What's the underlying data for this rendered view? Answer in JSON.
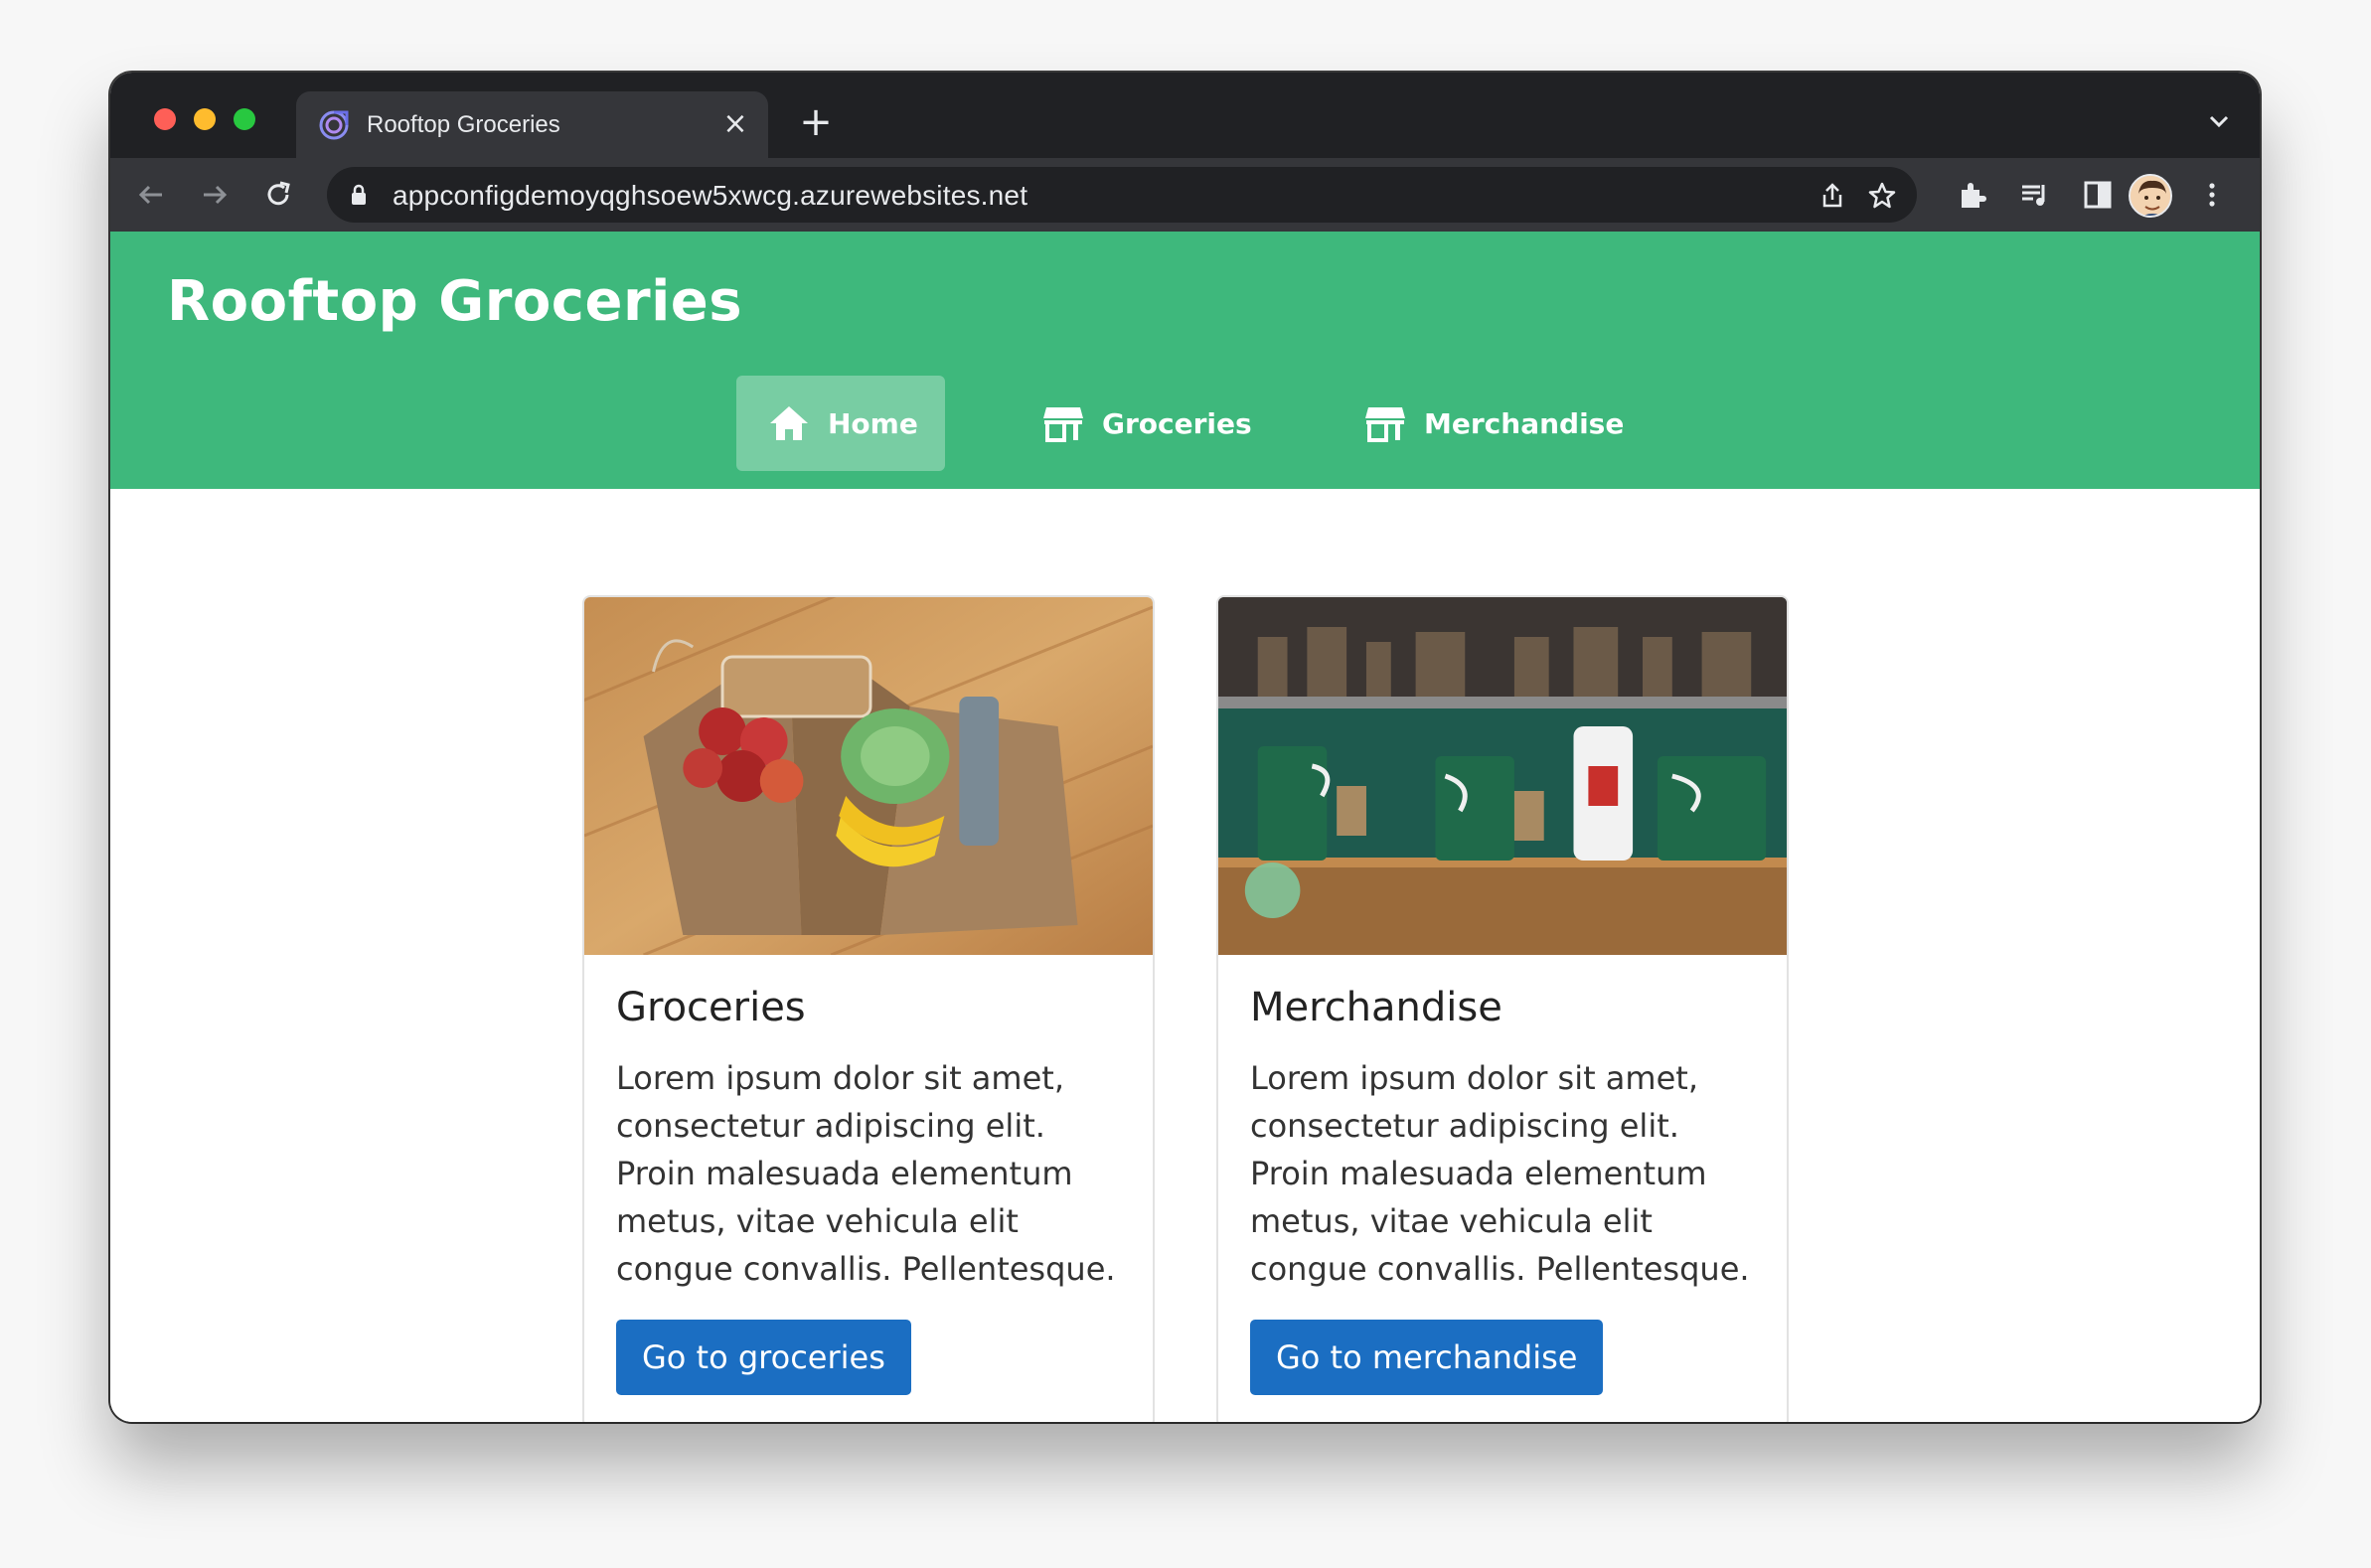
{
  "browser": {
    "tab_title": "Rooftop Groceries",
    "tab_close_glyph": "×",
    "new_tab_glyph": "+",
    "url": "appconfigdemoyqghsoew5xwcg.azurewebsites.net",
    "icons": [
      "back-arrow-icon",
      "forward-arrow-icon",
      "reload-icon",
      "lock-icon",
      "share-icon",
      "bookmark-star-icon",
      "extensions-icon",
      "media-controls-icon",
      "side-panel-icon",
      "profile-avatar",
      "more-menu-icon",
      "tab-search-icon"
    ]
  },
  "site": {
    "brand": "Rooftop Groceries",
    "colors": {
      "header": "#3eb87c",
      "button": "#1b6ec2"
    },
    "nav": [
      {
        "label": "Home",
        "icon": "home-icon",
        "active": true
      },
      {
        "label": "Groceries",
        "icon": "store-icon",
        "active": false
      },
      {
        "label": "Merchandise",
        "icon": "store-icon",
        "active": false
      }
    ]
  },
  "cards": [
    {
      "title": "Groceries",
      "text": "Lorem ipsum dolor sit amet, consectetur adipiscing elit. Proin malesuada elementum metus, vitae vehicula elit congue convallis. Pellentesque.",
      "button": "Go to groceries",
      "image": "grocery-bags-photo"
    },
    {
      "title": "Merchandise",
      "text": "Lorem ipsum dolor sit amet, consectetur adipiscing elit. Proin malesuada elementum metus, vitae vehicula elit congue convallis. Pellentesque.",
      "button": "Go to merchandise",
      "image": "coffee-mugs-photo"
    }
  ]
}
